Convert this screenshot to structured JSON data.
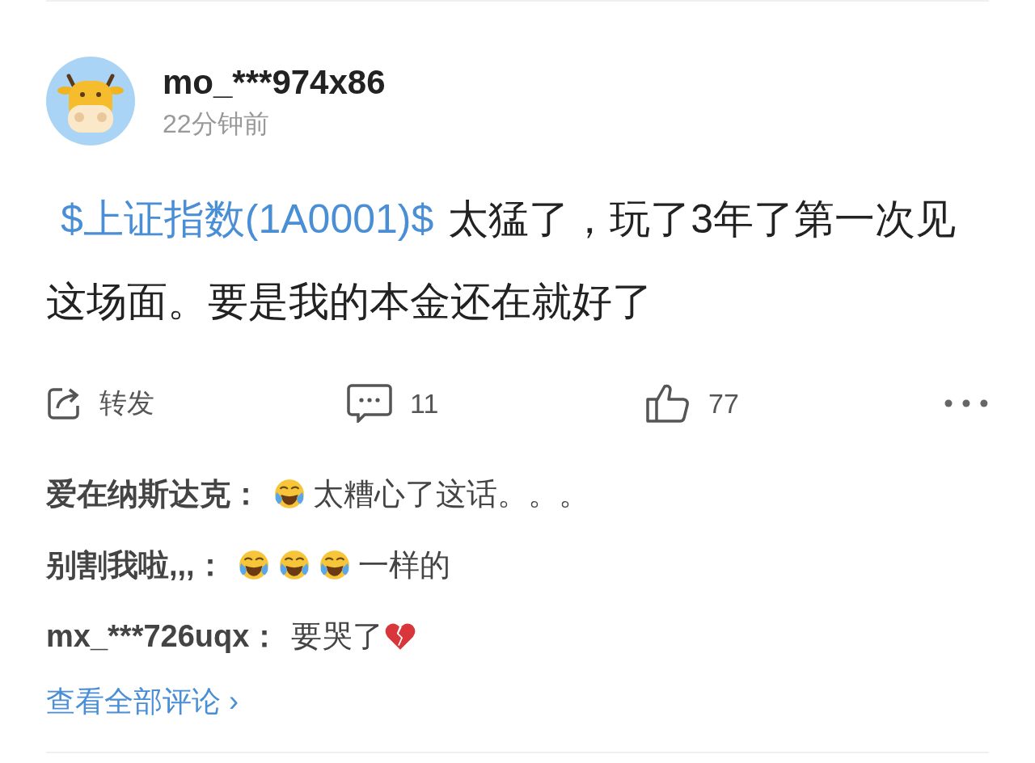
{
  "post": {
    "author": "mo_***974x86",
    "time": "22分钟前",
    "stock_tag": "$上证指数(1A0001)$",
    "text": "太猛了，玩了3年了第一次见这场面。要是我的本金还在就好了"
  },
  "actions": [
    {
      "kind": "repost",
      "label": "转发"
    },
    {
      "kind": "comment",
      "label": "11"
    },
    {
      "kind": "like",
      "label": "77"
    },
    {
      "kind": "more"
    }
  ],
  "comments": [
    {
      "name": "爱在纳斯达克",
      "separator": "：",
      "parts": [
        {
          "kind": "laugh-cry"
        },
        {
          "kind": "text",
          "text": "太糟心了这话。。。"
        }
      ]
    },
    {
      "name": "别割我啦,,,",
      "separator": "：",
      "parts": [
        {
          "kind": "laugh-cry"
        },
        {
          "kind": "laugh-cry"
        },
        {
          "kind": "laugh-cry"
        },
        {
          "kind": "text",
          "text": "一样的"
        }
      ]
    },
    {
      "name": "mx_***726uqx",
      "separator": "：",
      "parts": [
        {
          "kind": "text",
          "text": "要哭了"
        },
        {
          "kind": "broken-heart"
        }
      ]
    }
  ],
  "view_all": {
    "label": "查看全部评论",
    "chevron": "›"
  }
}
